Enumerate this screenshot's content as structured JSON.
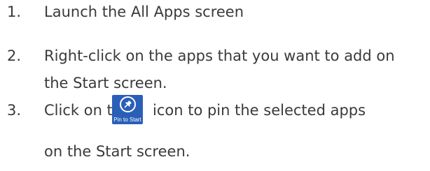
{
  "steps": [
    {
      "number": "1.",
      "text": "Launch the All Apps screen"
    },
    {
      "number": "2.",
      "line1": "Right-click on the apps that you want to add on",
      "line2": "the Start screen."
    },
    {
      "number": "3.",
      "before_icon": "Click on the",
      "after_icon": "icon to pin the selected apps",
      "line2": "on the Start screen.",
      "icon": {
        "name": "pin-icon",
        "caption": "Pin to Start",
        "color": "#2a5fb8"
      }
    }
  ]
}
